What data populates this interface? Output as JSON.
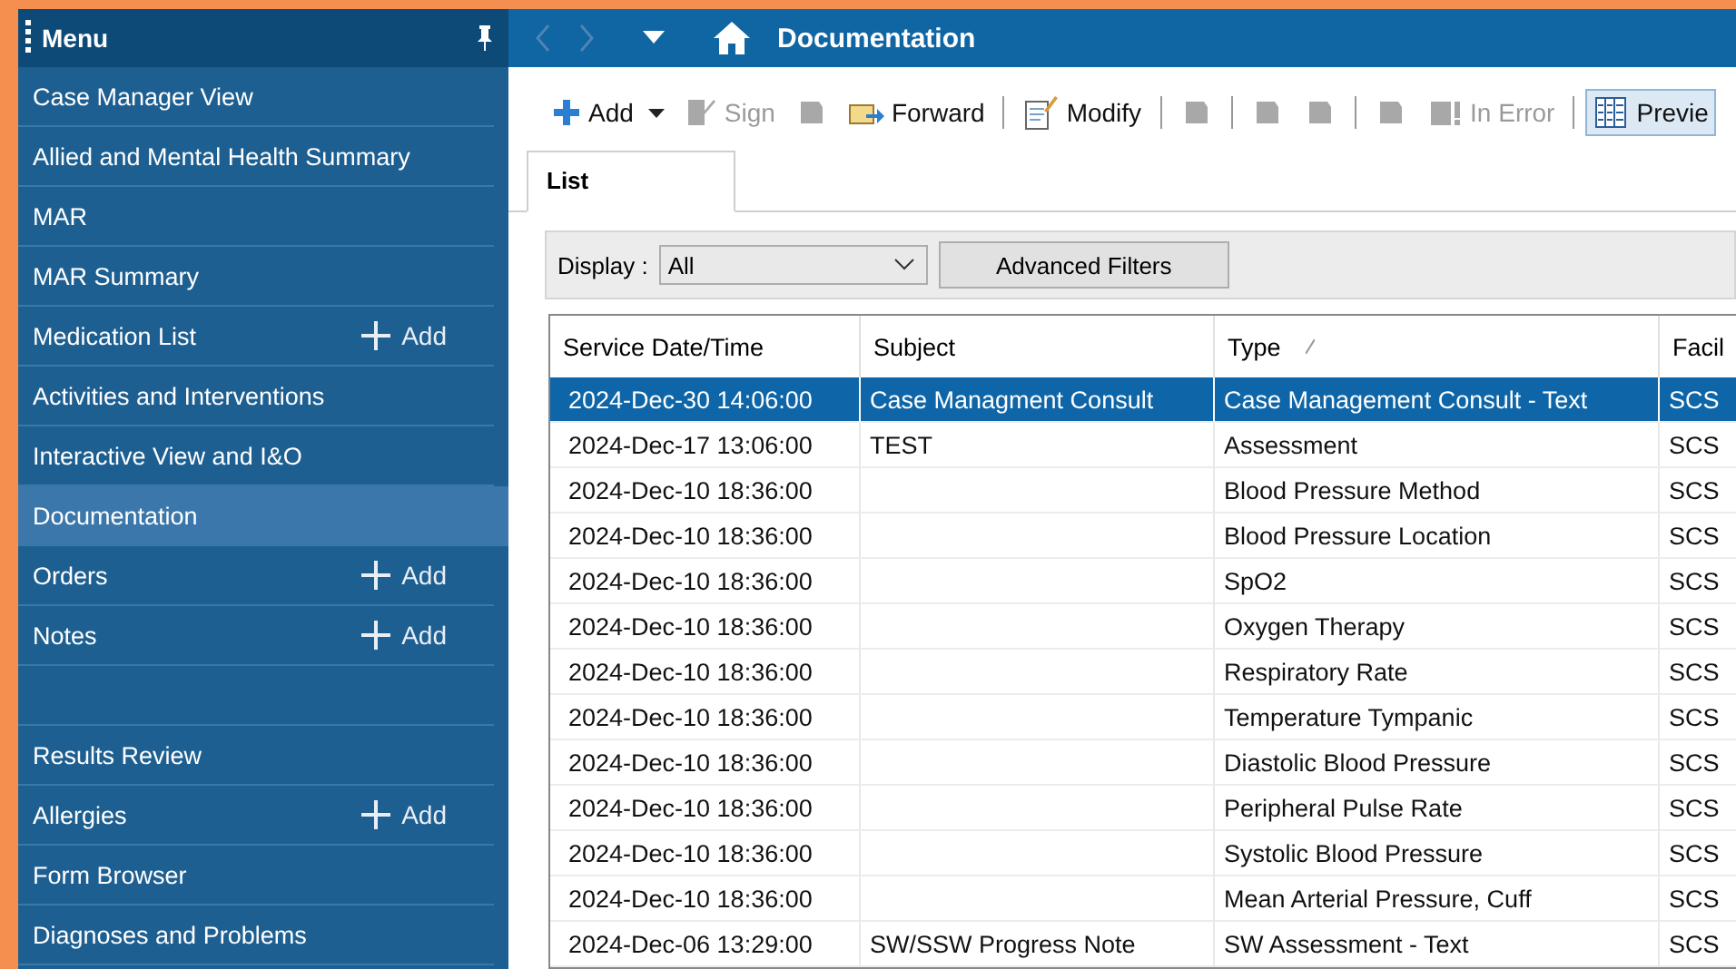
{
  "sidebar": {
    "title": "Menu",
    "items": [
      {
        "kind": "link",
        "label": "Case Manager View",
        "selected": false
      },
      {
        "kind": "link",
        "label": "Allied and Mental Health Summary",
        "selected": false
      },
      {
        "kind": "link",
        "label": "MAR",
        "selected": false
      },
      {
        "kind": "link",
        "label": "MAR Summary",
        "selected": false
      },
      {
        "kind": "link",
        "label": "Medication List",
        "selected": false,
        "add": "Add"
      },
      {
        "kind": "link",
        "label": "Activities and Interventions",
        "selected": false
      },
      {
        "kind": "link",
        "label": "Interactive View and I&O",
        "selected": false
      },
      {
        "kind": "link",
        "label": "Documentation",
        "selected": true
      },
      {
        "kind": "link",
        "label": "Orders",
        "selected": false,
        "add": "Add"
      },
      {
        "kind": "link",
        "label": "Notes",
        "selected": false,
        "add": "Add"
      },
      {
        "kind": "blank"
      },
      {
        "kind": "link",
        "label": "Results Review",
        "selected": false
      },
      {
        "kind": "link",
        "label": "Allergies",
        "selected": false,
        "add": "Add"
      },
      {
        "kind": "link",
        "label": "Form Browser",
        "selected": false
      },
      {
        "kind": "link",
        "label": "Diagnoses and Problems",
        "selected": false
      }
    ]
  },
  "header": {
    "title": "Documentation"
  },
  "toolbar": [
    {
      "kind": "add",
      "label": "Add",
      "disabled": false,
      "selected": false
    },
    {
      "kind": "sign",
      "label": "Sign",
      "disabled": true,
      "selected": false
    },
    {
      "kind": "blank",
      "disabled": true,
      "selected": false
    },
    {
      "kind": "forward",
      "label": "Forward",
      "disabled": false,
      "selected": false
    },
    {
      "kind": "sep"
    },
    {
      "kind": "modify",
      "label": "Modify",
      "disabled": false,
      "selected": false
    },
    {
      "kind": "sep"
    },
    {
      "kind": "blank",
      "disabled": true,
      "selected": false
    },
    {
      "kind": "sep"
    },
    {
      "kind": "blank",
      "disabled": true,
      "selected": false
    },
    {
      "kind": "blank",
      "disabled": true,
      "selected": false
    },
    {
      "kind": "sep"
    },
    {
      "kind": "blank",
      "disabled": true,
      "selected": false
    },
    {
      "kind": "error",
      "label": "In Error",
      "disabled": true,
      "selected": false
    },
    {
      "kind": "sep"
    },
    {
      "kind": "preview",
      "label": "Previe",
      "disabled": false,
      "selected": true
    }
  ],
  "tabs": [
    {
      "label": "List",
      "selected": true
    }
  ],
  "filters": {
    "display_label": "Display :",
    "display_value": "All",
    "button": "Advanced Filters"
  },
  "table": {
    "columns": [
      "Service Date/Time",
      "Subject",
      "Type",
      "Facil"
    ],
    "rows": [
      {
        "selected": true,
        "cells": [
          "2024-Dec-30 14:06:00",
          "Case Managment Consult",
          "Case Management Consult - Text",
          "SCS"
        ]
      },
      {
        "selected": false,
        "cells": [
          "2024-Dec-17 13:06:00",
          "TEST",
          "Assessment",
          "SCS"
        ]
      },
      {
        "selected": false,
        "cells": [
          "2024-Dec-10 18:36:00",
          "",
          "Blood Pressure Method",
          "SCS"
        ]
      },
      {
        "selected": false,
        "cells": [
          "2024-Dec-10 18:36:00",
          "",
          "Blood Pressure Location",
          "SCS"
        ]
      },
      {
        "selected": false,
        "cells": [
          "2024-Dec-10 18:36:00",
          "",
          "SpO2",
          "SCS"
        ]
      },
      {
        "selected": false,
        "cells": [
          "2024-Dec-10 18:36:00",
          "",
          "Oxygen Therapy",
          "SCS"
        ]
      },
      {
        "selected": false,
        "cells": [
          "2024-Dec-10 18:36:00",
          "",
          "Respiratory Rate",
          "SCS"
        ]
      },
      {
        "selected": false,
        "cells": [
          "2024-Dec-10 18:36:00",
          "",
          "Temperature Tympanic",
          "SCS"
        ]
      },
      {
        "selected": false,
        "cells": [
          "2024-Dec-10 18:36:00",
          "",
          "Diastolic Blood Pressure",
          "SCS"
        ]
      },
      {
        "selected": false,
        "cells": [
          "2024-Dec-10 18:36:00",
          "",
          "Peripheral Pulse Rate",
          "SCS"
        ]
      },
      {
        "selected": false,
        "cells": [
          "2024-Dec-10 18:36:00",
          "",
          "Systolic Blood Pressure",
          "SCS"
        ]
      },
      {
        "selected": false,
        "cells": [
          "2024-Dec-10 18:36:00",
          "",
          "Mean Arterial Pressure, Cuff",
          "SCS"
        ]
      },
      {
        "selected": false,
        "cells": [
          "2024-Dec-06 13:29:00",
          "SW/SSW Progress Note",
          "SW Assessment - Text",
          "SCS"
        ]
      }
    ]
  }
}
